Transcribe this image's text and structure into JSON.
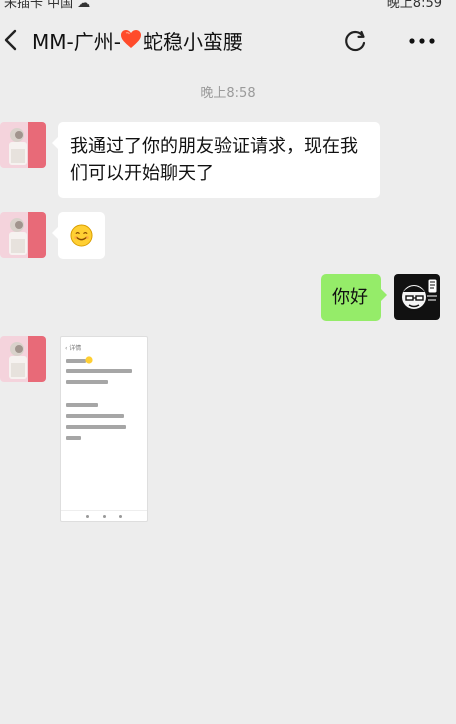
{
  "status": {
    "left_text": "未插卡 中国 ☁",
    "right_text": "晚上8:59"
  },
  "nav": {
    "title_prefix": "MM-广州-",
    "title_suffix": "蛇稳小蛮腰",
    "back_icon": "back-icon",
    "refresh_icon": "refresh-icon",
    "more_icon": "more-icon"
  },
  "chat": {
    "timestamp": "晚上8:58",
    "messages": [
      {
        "side": "left",
        "type": "text",
        "text": "我通过了你的朋友验证请求，现在我们可以开始聊天了"
      },
      {
        "side": "left",
        "type": "emoji",
        "emoji": "smiling-emoji"
      },
      {
        "side": "right",
        "type": "text",
        "text": "你好"
      },
      {
        "side": "left",
        "type": "image"
      }
    ]
  },
  "colors": {
    "background": "#ededed",
    "bubble_left": "#ffffff",
    "bubble_right": "#95ec69",
    "timestamp": "#9a9a9a",
    "heart": "#ff4b2b"
  }
}
